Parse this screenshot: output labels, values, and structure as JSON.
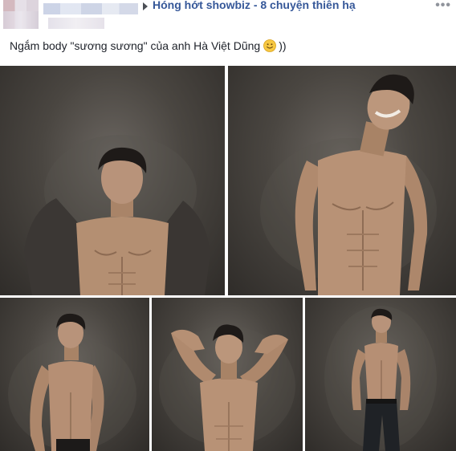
{
  "header": {
    "group_name": "Hóng hớt showbiz - 8 chuyện thiên hạ",
    "more_icon": "more-options-icon",
    "share_arrow_icon": "triangle-right-icon"
  },
  "post": {
    "text": "Ngắm body \"sương sương\" của anh Hà Việt Dũng",
    "emoji": "slightly-smiling-face",
    "text_tail": "))"
  },
  "photos": [
    {
      "name": "photo-1",
      "pose": "jacket-open"
    },
    {
      "name": "photo-2",
      "pose": "laughing"
    },
    {
      "name": "photo-3",
      "pose": "torso-hand-on-hip"
    },
    {
      "name": "photo-4",
      "pose": "arms-behind-head"
    },
    {
      "name": "photo-5",
      "pose": "full-body-jeans"
    }
  ],
  "colors": {
    "link": "#365899",
    "text": "#1d2129",
    "backdrop": "#4a4641",
    "skin": "#b59276"
  }
}
